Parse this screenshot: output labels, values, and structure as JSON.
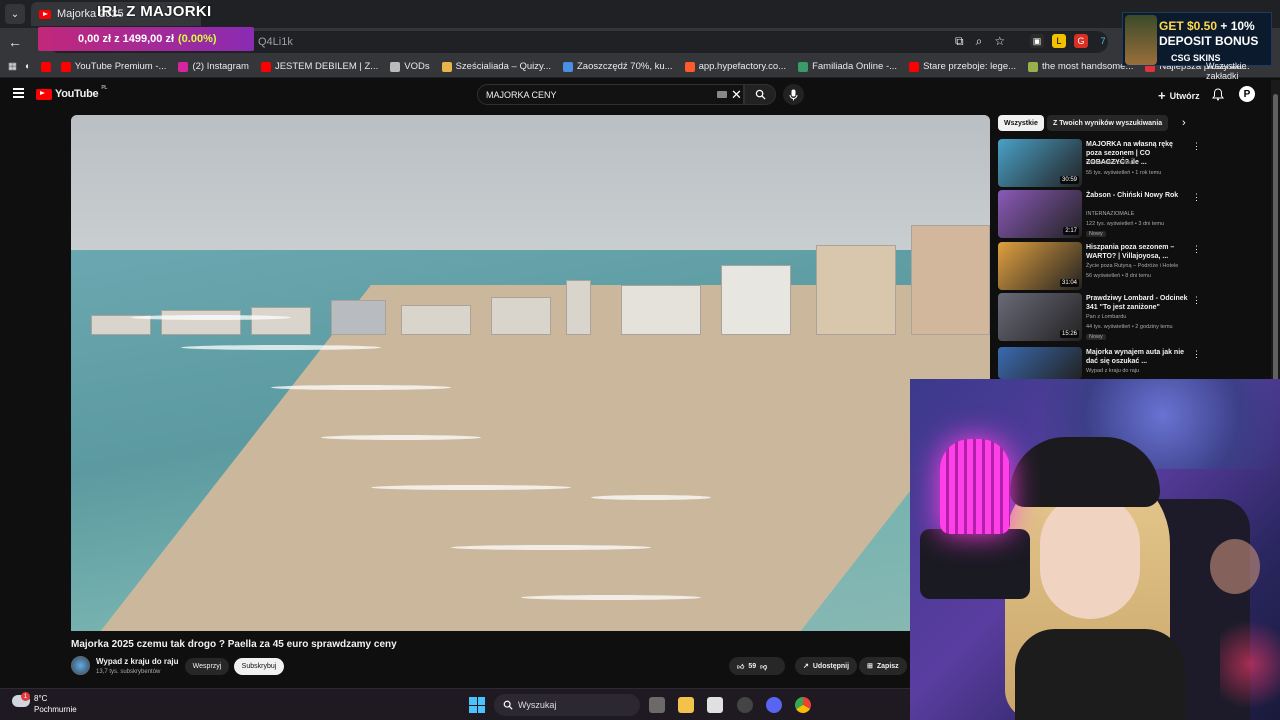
{
  "browser": {
    "tab_title": "Majorka 2025",
    "overlay_title": "IRL Z MAJORKI",
    "url_fragment": "Q4Li1k",
    "donation": {
      "amount": "0,00 zł z 1499,00 zł",
      "percent": "(0.00%)"
    }
  },
  "bookmarks": [
    {
      "label": "YouTube Premium -...",
      "color": "#ff0000"
    },
    {
      "label": "(2) Instagram",
      "color": "#d6249f"
    },
    {
      "label": "JESTEM DEBILEM | Z...",
      "color": "#ff0000"
    },
    {
      "label": "VODs",
      "color": "#bbbbbb"
    },
    {
      "label": "Sześcialiada – Quizy...",
      "color": "#e8b54a"
    },
    {
      "label": "Zaoszczędź 70%, ku...",
      "color": "#4a90e2"
    },
    {
      "label": "app.hypefactory.co...",
      "color": "#ff5a2a"
    },
    {
      "label": "Familiada Online -...",
      "color": "#3a9a6a"
    },
    {
      "label": "Stare przeboje: lege...",
      "color": "#ff0000"
    },
    {
      "label": "the most handsome...",
      "color": "#9ab04a"
    },
    {
      "label": "Najlepsza piosenka...",
      "color": "#e2333a"
    }
  ],
  "all_bookmarks": "Wszystkie zakładki",
  "promo": {
    "line1": "GET $0.50",
    "line1b": " + 10%",
    "line2": "DEPOSIT BONUS",
    "brand": "CSG SKINS"
  },
  "youtube": {
    "logo": "YouTube",
    "country": "PL",
    "search_value": "MAJORKA CENY",
    "create_label": "Utwórz",
    "avatar_letter": "P"
  },
  "video": {
    "title": "Majorka 2025 czemu tak drogo ? Paella za 45 euro sprawdzamy ceny",
    "channel": "Wypad z kraju do raju",
    "subscribers": "13,7 tys. subskrybentów",
    "join_label": "Wesprzyj",
    "subscribe_label": "Subskrybuj",
    "likes": "59",
    "share_label": "Udostępnij",
    "save_label": "Zapisz"
  },
  "sidebar": {
    "chips": [
      "Wszystkie",
      "Z Twoich wyników wyszukiwania"
    ],
    "recs": [
      {
        "title": "MAJORKA na własną rękę poza sezonem | CO ZOBACZYĆ? ile ...",
        "channel": "milena.wilamowska",
        "meta": "55 tys. wyświetleń • 1 rok temu",
        "duration": "30:59",
        "badge": "",
        "thumb": "#4aa0c8"
      },
      {
        "title": "Żabson - Chiński Nowy Rok",
        "channel": "INTERNAZIOMALE",
        "meta": "122 tys. wyświetleń • 3 dni temu",
        "duration": "2:17",
        "badge": "Nowy",
        "thumb": "#8a5ab8"
      },
      {
        "title": "Hiszpania poza sezonem – WARTO? | Villajoyosa, ...",
        "channel": "Życie poza Rutyną – Podróże i Hotele",
        "meta": "56 wyświetleń • 8 dni temu",
        "duration": "31:04",
        "badge": "",
        "thumb": "#e0a040"
      },
      {
        "title": "Prawdziwy Lombard - Odcinek 341 \"To jest zaniżone\"",
        "channel": "Pan z Lombardu",
        "meta": "44 tys. wyświetleń • 2 godziny temu",
        "duration": "15:26",
        "badge": "Nowy",
        "thumb": "#6a6a78"
      },
      {
        "title": "Majorka wynajem auta jak nie dać się oszukać ...",
        "channel": "Wypad z kraju do raju",
        "meta": "",
        "duration": "",
        "badge": "",
        "thumb": "#3a6ab0"
      }
    ]
  },
  "taskbar": {
    "temperature": "8°C",
    "weather": "Pochmurnie",
    "weather_badge": "1",
    "search_placeholder": "Wyszukaj"
  }
}
